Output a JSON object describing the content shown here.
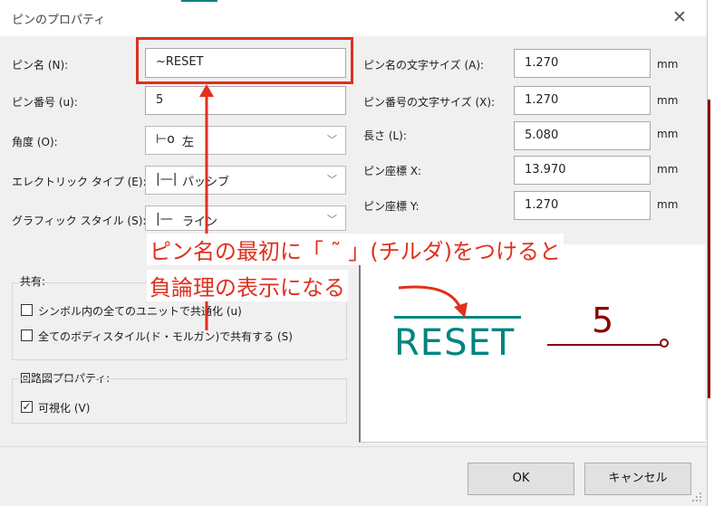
{
  "window": {
    "title": "ピンのプロパティ",
    "close_glyph": "✕"
  },
  "fields": {
    "pin_name": {
      "label": "ピン名 (N):",
      "value": "~RESET"
    },
    "pin_number": {
      "label": "ピン番号 (u):",
      "value": "5"
    },
    "angle": {
      "label": "角度 (O):",
      "value": "左",
      "glyph": "⊢o"
    },
    "electrical_type": {
      "label": "エレクトリック タイプ (E):",
      "value": "パッシブ",
      "glyph": "|—|"
    },
    "graphic_style": {
      "label": "グラフィック スタイル (S):",
      "value": "ライン",
      "glyph": "|—"
    },
    "name_text_size": {
      "label": "ピン名の文字サイズ (A):",
      "value": "1.270",
      "unit": "mm"
    },
    "number_text_size": {
      "label": "ピン番号の文字サイズ (X):",
      "value": "1.270",
      "unit": "mm"
    },
    "length": {
      "label": "長さ (L):",
      "value": "5.080",
      "unit": "mm"
    },
    "pos_x": {
      "label": "ピン座標 X:",
      "value": "13.970",
      "unit": "mm"
    },
    "pos_y": {
      "label": "ピン座標 Y:",
      "value": "1.270",
      "unit": "mm"
    }
  },
  "shared_group": {
    "title": "共有:",
    "common_units": {
      "label": "シンボル内の全てのユニットで共通化 (u)",
      "checked": false
    },
    "common_styles": {
      "label": "全てのボディスタイル(ド・モルガン)で共有する (S)",
      "checked": false
    }
  },
  "schematic_group": {
    "title": "回路図プロパティ:",
    "visible": {
      "label": "可視化 (V)",
      "checked": true,
      "mark": "✓"
    }
  },
  "preview": {
    "pin_name": "RESET",
    "pin_number": "5",
    "name_color": "#00847f",
    "pin_color": "#8b0000"
  },
  "annotation": {
    "line1": "ピン名の最初に「 ˜ 」(チルダ)をつけると",
    "line2": "負論理の表示になる",
    "color": "#e0301e"
  },
  "buttons": {
    "ok": "OK",
    "cancel": "キャンセル"
  }
}
